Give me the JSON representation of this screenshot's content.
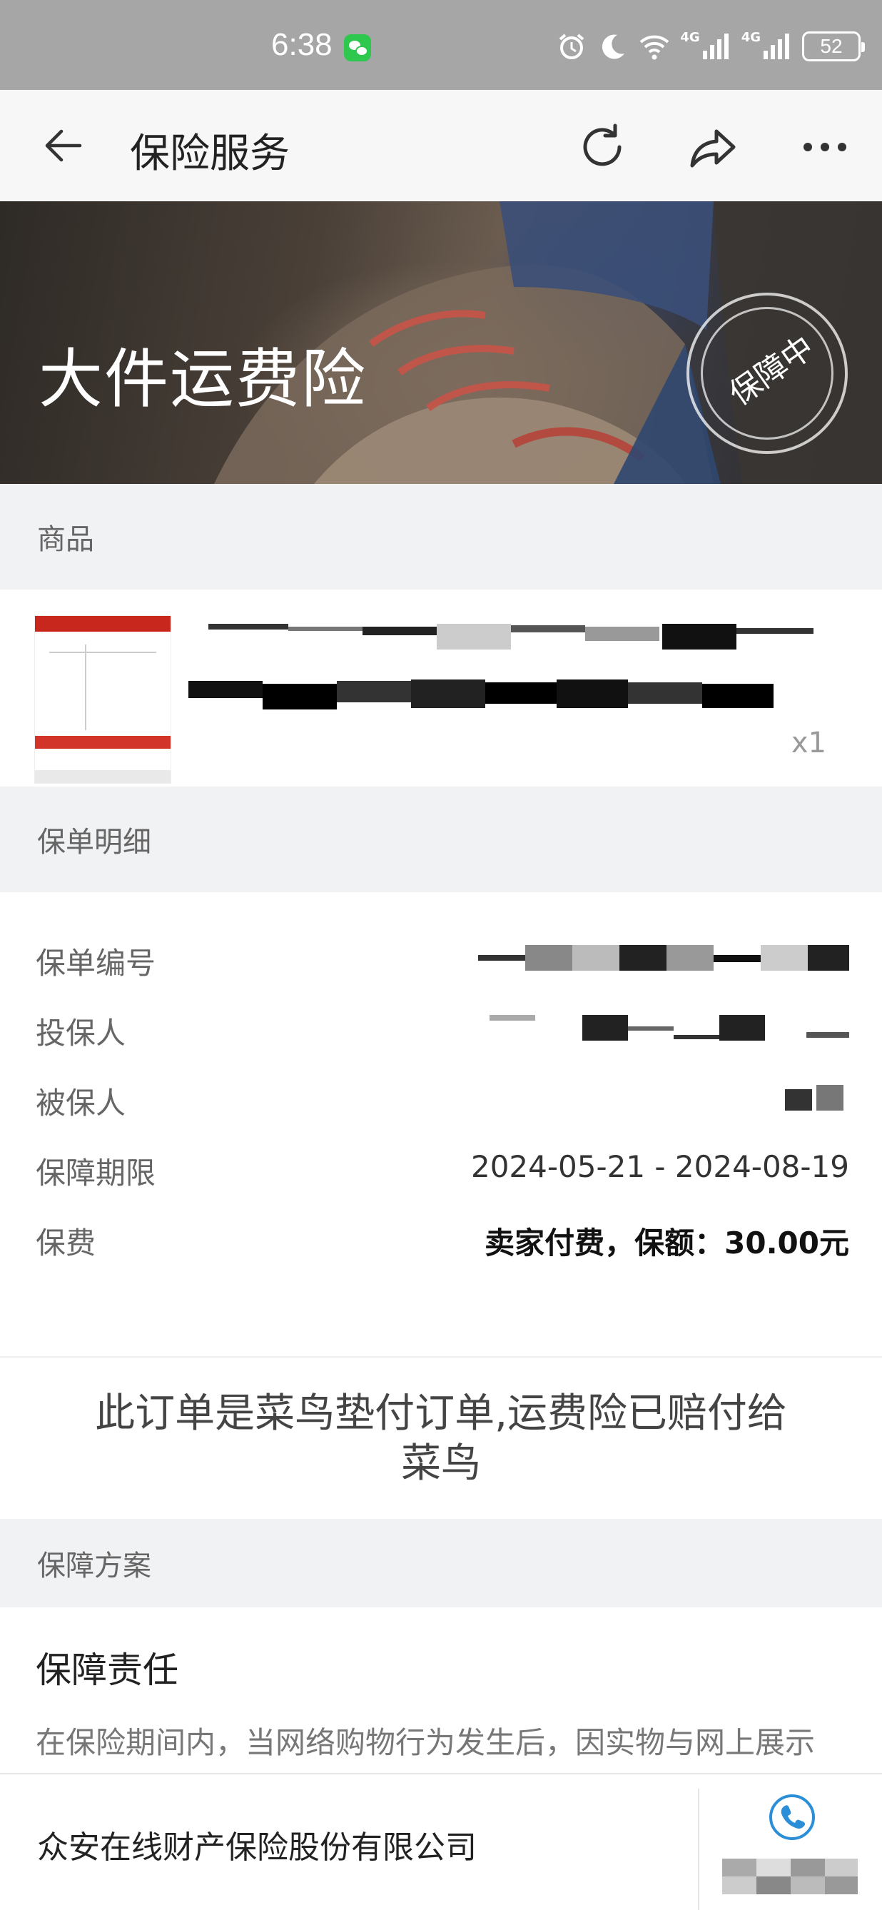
{
  "status_bar": {
    "time": "6:38",
    "battery": "52",
    "network_1": "4G",
    "network_2": "4G"
  },
  "nav": {
    "title": "保险服务"
  },
  "banner": {
    "title": "大件运费险",
    "stamp": "保障中"
  },
  "product_section": {
    "header": "商品",
    "quantity": "x1"
  },
  "policy_section": {
    "header": "保单明细",
    "rows": [
      {
        "label": "保单编号",
        "value": ""
      },
      {
        "label": "投保人",
        "value": ""
      },
      {
        "label": "被保人",
        "value": ""
      },
      {
        "label": "保障期限",
        "value": "2024-05-21 - 2024-08-19"
      },
      {
        "label": "保费",
        "value": "卖家付费，保额：30.00元"
      }
    ]
  },
  "notice": {
    "line1": "此订单是菜鸟垫付订单,运费险已赔付给",
    "line2": "菜鸟"
  },
  "plan_section": {
    "header": "保障方案",
    "title": "保障责任",
    "text": "在保险期间内，当网络购物行为发生后，因实物与网上展示"
  },
  "footer": {
    "company": "众安在线财产保险股份有限公司"
  },
  "colors": {
    "status_bar": "#a6a6a6",
    "section_bg": "#f1f2f4",
    "brand_green": "#2dc84d",
    "phone_blue": "#2a8fd8"
  },
  "icons": [
    "back-arrow-icon",
    "refresh-icon",
    "share-icon",
    "more-icon",
    "alarm-icon",
    "moon-icon",
    "wifi-icon",
    "signal-icon",
    "phone-icon",
    "wechat-icon"
  ]
}
